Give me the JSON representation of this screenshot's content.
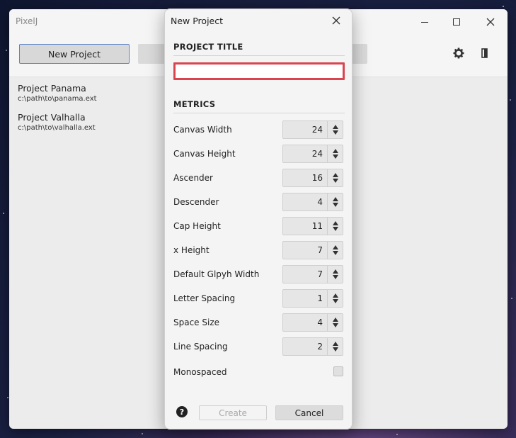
{
  "app": {
    "title": "PixelJ",
    "toolbar": {
      "new_project_label": "New Project"
    },
    "projects": [
      {
        "name": "Project Panama",
        "path": "c:\\path\\to\\panama.ext"
      },
      {
        "name": "Project Valhalla",
        "path": "c:\\path\\to\\valhalla.ext"
      }
    ]
  },
  "dialog": {
    "title": "New Project",
    "project_title_heading": "PROJECT TITLE",
    "project_title_value": "",
    "metrics_heading": "METRICS",
    "metrics": [
      {
        "label": "Canvas Width",
        "value": "24"
      },
      {
        "label": "Canvas Height",
        "value": "24"
      },
      {
        "label": "Ascender",
        "value": "16"
      },
      {
        "label": "Descender",
        "value": "4"
      },
      {
        "label": "Cap Height",
        "value": "11"
      },
      {
        "label": "x Height",
        "value": "7"
      },
      {
        "label": "Default Glpyh Width",
        "value": "7"
      },
      {
        "label": "Letter Spacing",
        "value": "1"
      },
      {
        "label": "Space Size",
        "value": "4"
      },
      {
        "label": "Line Spacing",
        "value": "2"
      }
    ],
    "monospaced_label": "Monospaced",
    "monospaced_checked": false,
    "help_glyph": "?",
    "create_label": "Create",
    "cancel_label": "Cancel"
  },
  "colors": {
    "accent": "#5b83c4",
    "error_border": "#d9454f"
  }
}
